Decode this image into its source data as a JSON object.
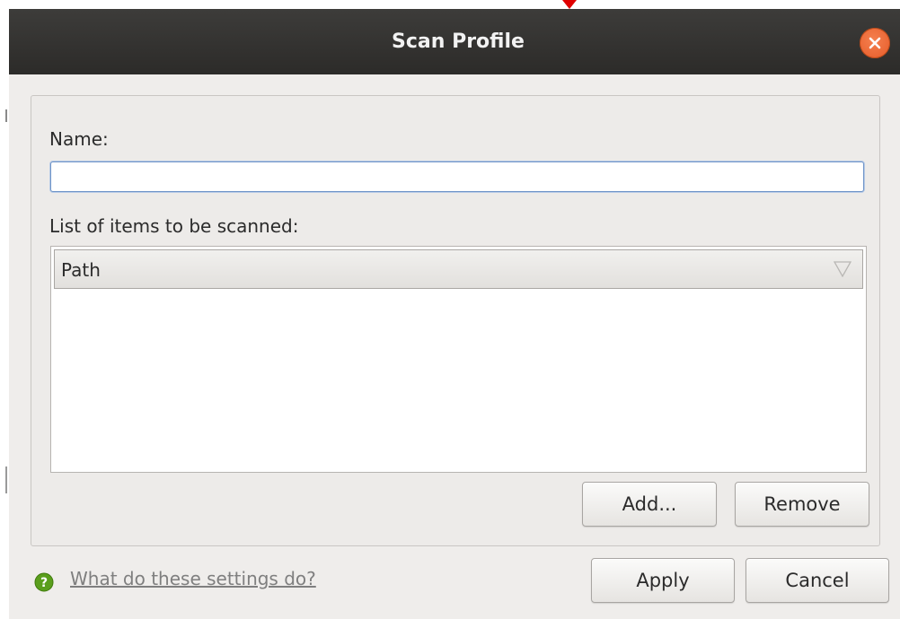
{
  "window": {
    "title": "Scan Profile",
    "close_icon": "close-icon"
  },
  "form": {
    "name_label": "Name:",
    "name_value": "",
    "name_placeholder": "",
    "items_label": "List of items to be scanned:",
    "table": {
      "columns": [
        "Path"
      ],
      "sort_icon": "sort-indicator-icon",
      "rows": []
    },
    "add_label": "Add...",
    "remove_label": "Remove"
  },
  "footer": {
    "help_icon": "help-icon",
    "help_link": "What do these settings do?",
    "apply_label": "Apply",
    "cancel_label": "Cancel"
  },
  "colors": {
    "titlebar": "#2c2b29",
    "close_button": "#e55a28",
    "dialog_background": "#efedeb",
    "input_focus_border": "#6f94c8",
    "help_icon": "#4e9a06",
    "pointer_marker": "#e00000"
  }
}
